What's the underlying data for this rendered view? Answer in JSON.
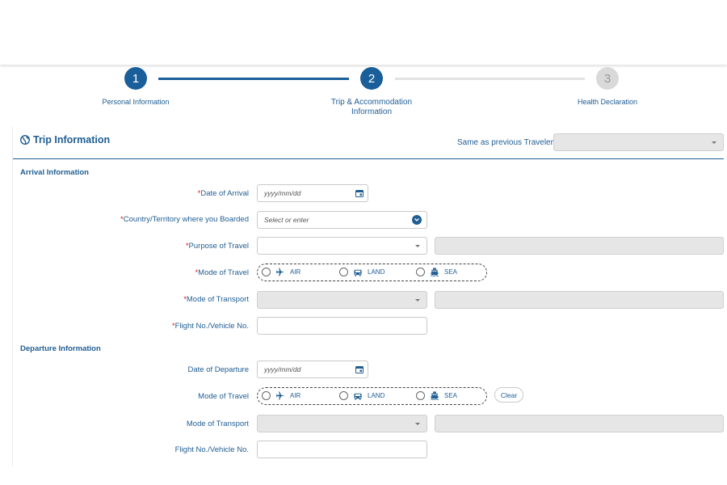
{
  "stepper": {
    "steps": [
      {
        "number": "1",
        "label": "Personal Information"
      },
      {
        "number": "2",
        "label": "Trip & Accommodation Information"
      },
      {
        "number": "3",
        "label": "Health Declaration"
      }
    ],
    "active_step": 2,
    "colors": {
      "active": "#1a5f99",
      "inactive": "#d9d9d9"
    }
  },
  "trip": {
    "title": "Trip Information",
    "same_as_label": "Same as previous Traveler"
  },
  "arrival": {
    "section_title": "Arrival Information",
    "date_label": "Date of Arrival",
    "date_placeholder": "yyyy/mm/dd",
    "country_label": "Country/Territory where you Boarded",
    "country_placeholder": "Select or enter",
    "purpose_label": "Purpose of Travel",
    "mode_label": "Mode of Travel",
    "transport_label": "Mode of Transport",
    "flight_label": "Flight No./Vehicle No."
  },
  "departure": {
    "section_title": "Departure Information",
    "date_label": "Date of Departure",
    "date_placeholder": "yyyy/mm/dd",
    "mode_label": "Mode of Travel",
    "clear_label": "Clear",
    "transport_label": "Mode of Transport",
    "flight_label": "Flight No./Vehicle No."
  },
  "travel_modes": [
    {
      "label": "AIR",
      "icon": "airplane-icon"
    },
    {
      "label": "LAND",
      "icon": "car-icon"
    },
    {
      "label": "SEA",
      "icon": "ship-icon"
    }
  ],
  "required_marker": "*",
  "colors": {
    "accent": "#1f5d93",
    "required": "#d21c1c",
    "disabled_field": "#e6e6e6"
  }
}
